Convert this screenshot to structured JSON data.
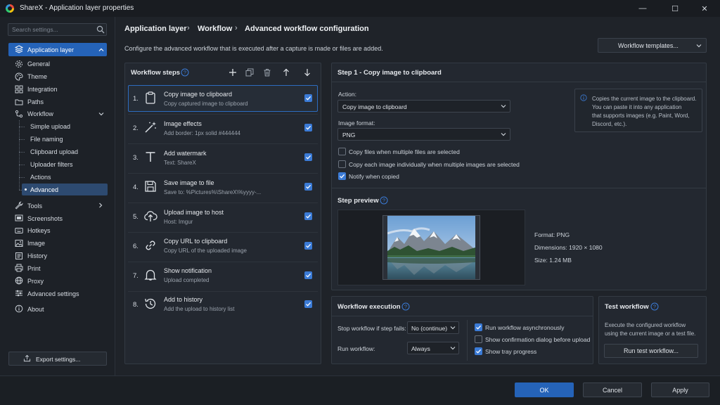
{
  "window": {
    "title": "ShareX - Application layer properties",
    "minimize": "—",
    "maximize": "☐",
    "close": "✕"
  },
  "sidebar": {
    "search_placeholder": "Search settings...",
    "items": [
      {
        "label": "Application layer"
      },
      {
        "label": "General"
      },
      {
        "label": "Theme"
      },
      {
        "label": "Integration"
      },
      {
        "label": "Paths"
      },
      {
        "label": "Workflow"
      },
      {
        "label": "Simple upload"
      },
      {
        "label": "File naming"
      },
      {
        "label": "Clipboard upload"
      },
      {
        "label": "Uploader filters"
      },
      {
        "label": "Actions"
      },
      {
        "label": "Advanced"
      },
      {
        "label": "Tools"
      },
      {
        "label": "Screenshots"
      },
      {
        "label": "Hotkeys"
      },
      {
        "label": "Image"
      },
      {
        "label": "History"
      },
      {
        "label": "Print"
      },
      {
        "label": "Proxy"
      },
      {
        "label": "Advanced settings"
      },
      {
        "label": "About"
      }
    ],
    "export_label": "Export settings..."
  },
  "breadcrumb": [
    "Application layer",
    "Workflow",
    "Advanced workflow configuration"
  ],
  "page_desc": "Configure the advanced workflow that is executed after a capture is made or files are added.",
  "templates_label": "Workflow templates...",
  "steps": {
    "title": "Workflow steps",
    "items": [
      {
        "num": "1.",
        "title": "Copy image to clipboard",
        "sub": "Copy captured image to clipboard"
      },
      {
        "num": "2.",
        "title": "Image effects",
        "sub": "Add border: 1px solid #444444"
      },
      {
        "num": "3.",
        "title": "Add watermark",
        "sub": "Text: ShareX"
      },
      {
        "num": "4.",
        "title": "Save image to file",
        "sub": "Save to: %Pictures%\\ShareX\\%yyyy-..."
      },
      {
        "num": "5.",
        "title": "Upload image to host",
        "sub": "Host: Imgur"
      },
      {
        "num": "6.",
        "title": "Copy URL to clipboard",
        "sub": "Copy URL of the uploaded image"
      },
      {
        "num": "7.",
        "title": "Show notification",
        "sub": "Upload completed"
      },
      {
        "num": "8.",
        "title": "Add to history",
        "sub": "Add the upload to history list"
      }
    ]
  },
  "detail": {
    "title": "Step 1 - Copy image to clipboard",
    "action_label": "Action:",
    "action_value": "Copy image to clipboard",
    "format_label": "Image format:",
    "format_value": "PNG",
    "options": [
      "Copy files when multiple files are selected",
      "Copy each image individually when multiple images are selected",
      "Notify when copied"
    ],
    "info": "Copies the current image to the clipboard. You can paste it into any application that supports images (e.g. Paint, Word, Discord, etc.).",
    "info_lines": [
      "Copies the current image to the clipboard.",
      "You can paste it into any application",
      "that supports images (e.g. Paint, Word,",
      "Discord, etc.)."
    ],
    "preview_title": "Step preview",
    "preview_format": "Format: PNG",
    "preview_dimensions": "Dimensions: 1920 × 1080",
    "preview_size": "Size: 1.24 MB"
  },
  "execution": {
    "title": "Workflow execution",
    "stop_label": "Stop workflow if step fails:",
    "stop_value": "No (continue)",
    "run_label": "Run workflow:",
    "run_value": "Always",
    "options": [
      "Run workflow asynchronously",
      "Show confirmation dialog before upload",
      "Show tray progress"
    ]
  },
  "test": {
    "title": "Test workflow",
    "desc_lines": [
      "Execute the configured workflow",
      "using the current image or a test file."
    ],
    "button": "Run test workflow..."
  },
  "footer": {
    "ok": "OK",
    "cancel": "Cancel",
    "apply": "Apply"
  },
  "colors": {
    "accent": "#2563b8",
    "checkbox": "#3b7bd6",
    "background": "#1f2329"
  }
}
